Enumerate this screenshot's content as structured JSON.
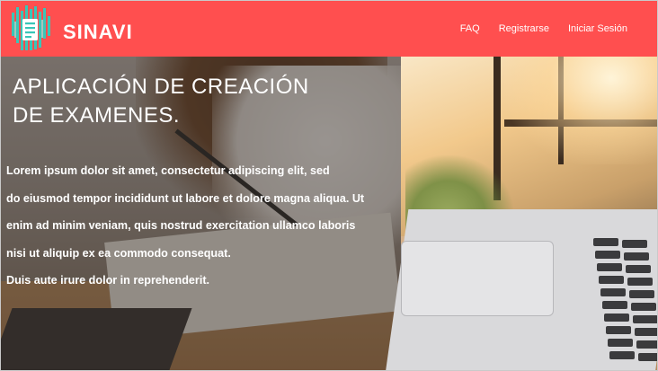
{
  "brand": {
    "name": "SINAVI",
    "logo_icon": "document-list-icon",
    "colors": {
      "navbar": "#ff4f4f",
      "logo_teal": "#39c6b8"
    }
  },
  "nav": {
    "items": [
      {
        "label": "FAQ"
      },
      {
        "label": "Registrarse"
      },
      {
        "label": "Iniciar Sesión"
      }
    ]
  },
  "hero": {
    "title_lines": [
      "APLICACIÓN DE CREACIÓN",
      "DE EXAMENES."
    ],
    "body_lines": [
      "Lorem ipsum dolor sit amet, consectetur adipiscing elit, sed",
      "do eiusmod tempor incididunt ut labore et dolore magna aliqua. Ut",
      "enim ad minim veniam, quis nostrud exercitation ullamco laboris",
      "nisi ut aliquip ex ea commodo consequat.",
      "Duis aute irure dolor in reprehenderit."
    ]
  }
}
